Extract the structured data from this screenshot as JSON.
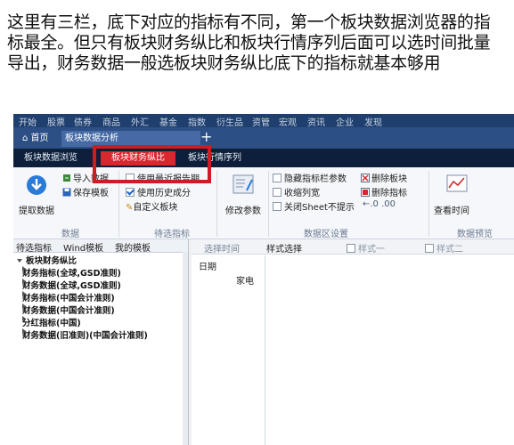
{
  "caption": "这里有三栏，底下对应的指标有不同，第一个板块数据浏览器的指标最全。但只有板块财务纵比和板块行情序列后面可以选时间批量导出，财务数据一般选板块财务纵比底下的指标就基本够用",
  "menu": [
    "开始",
    "股票",
    "债券",
    "商品",
    "外汇",
    "基金",
    "指数",
    "衍生品",
    "资管",
    "宏观",
    "资讯",
    "企业",
    "发现"
  ],
  "tabs": {
    "home": "首页",
    "active": "板块数据分析",
    "add": "+"
  },
  "subtabs": [
    "板块数据浏览",
    "板块财务纵比",
    "板块行情序列"
  ],
  "ribbon": {
    "extract": "提取数据",
    "import": "导入数据",
    "save_template": "保存模板",
    "use_latest_period": "使用最近报告期",
    "use_history": "使用历史成分",
    "custom_sector": "自定义板块",
    "edit_params": "修改参数",
    "hide_params": "隐藏指标栏参数",
    "shrink_cols": "收缩列宽",
    "close_sheet": "关闭Sheet不提示",
    "delete_sector": "删除板块",
    "delete_indicator": "删除指标",
    "view_more": "查看时间",
    "group_data": "数据",
    "group_indicator": "待选指标",
    "group_area": "数据区设置",
    "group_view": "数据预览"
  },
  "left_tabs": [
    "待选指标",
    "Wind模板",
    "我的模板"
  ],
  "tree": {
    "root": "板块财务纵比",
    "children": [
      "财务指标(全球,GSD准则)",
      "财务数据(全球,GSD准则)",
      "财务指标(中国会计准则)",
      "财务数据(中国会计准则)",
      "分红指标(中国)",
      "财务数据(旧准则)(中国会计准则)"
    ]
  },
  "right_toolbar": {
    "select_time": "选择时间",
    "style_select": "样式选择",
    "style1": "样式一",
    "style2": "样式二"
  },
  "grid": {
    "date": "日期",
    "count": "家电"
  },
  "colors": {
    "menubar": "#1f3f6e",
    "tabbar": "#2c4f85",
    "subtabs": "#0d1f3b",
    "highlight": "#d8272d"
  }
}
